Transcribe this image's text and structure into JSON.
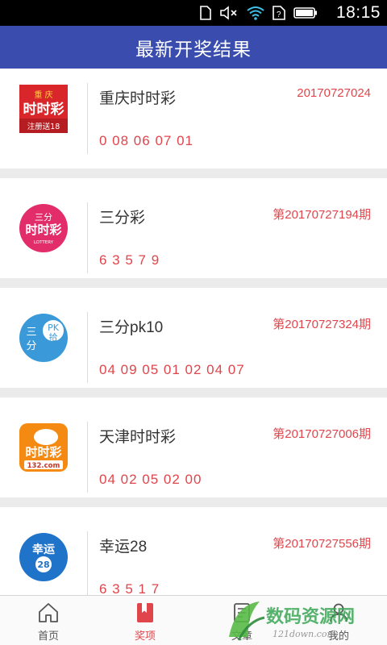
{
  "status_bar": {
    "time": "18:15",
    "icons": [
      "sim-card-icon",
      "mute-icon",
      "wifi-icon",
      "sim-card-icon",
      "battery-icon"
    ]
  },
  "header": {
    "title": "最新开奖结果"
  },
  "lotteries": [
    {
      "name": "重庆时时彩",
      "period": "20170727024",
      "numbers": "0 08 06 07 01",
      "logo": {
        "icon": "chongqing-ssc-logo-icon",
        "line1": "重 庆",
        "line2": "时时彩",
        "line3": "注册送18"
      }
    },
    {
      "name": "三分彩",
      "period": "第20170727194期",
      "numbers": "6 3 5 7 9",
      "logo": {
        "icon": "sanfen-cai-logo-icon",
        "line1": "三分",
        "line2": "时时彩",
        "line3": "LOTTERY"
      }
    },
    {
      "name": "三分pk10",
      "period": "第20170727324期",
      "numbers": "04 09 05 01 02 04 07",
      "logo": {
        "icon": "sanfen-pk10-logo-icon",
        "line1": "三",
        "line2": "分",
        "line3": "PK",
        "line4": "拾"
      }
    },
    {
      "name": "天津时时彩",
      "period": "第20170727006期",
      "numbers": "04 02 05 02 00",
      "logo": {
        "icon": "tianjin-ssc-logo-icon",
        "line1": "时时彩",
        "line2": "132.com"
      }
    },
    {
      "name": "幸运28",
      "period": "第20170727556期",
      "numbers": "6 3 5 1 7",
      "logo": {
        "icon": "xingyun28-logo-icon",
        "line1": "幸运",
        "line2": "28"
      }
    }
  ],
  "tabbar": {
    "tabs": [
      {
        "label": "首页",
        "icon": "home-icon",
        "active": false
      },
      {
        "label": "奖项",
        "icon": "bookmark-icon",
        "active": true
      },
      {
        "label": "文章",
        "icon": "article-icon",
        "active": false
      },
      {
        "label": "我的",
        "icon": "profile-icon",
        "active": false
      }
    ]
  },
  "watermark": {
    "text1": "数码资源网",
    "text2": "121down.com"
  },
  "colors": {
    "header_bg": "#3a4cad",
    "accent_red": "#e0454b",
    "separator": "#ebebeb"
  }
}
